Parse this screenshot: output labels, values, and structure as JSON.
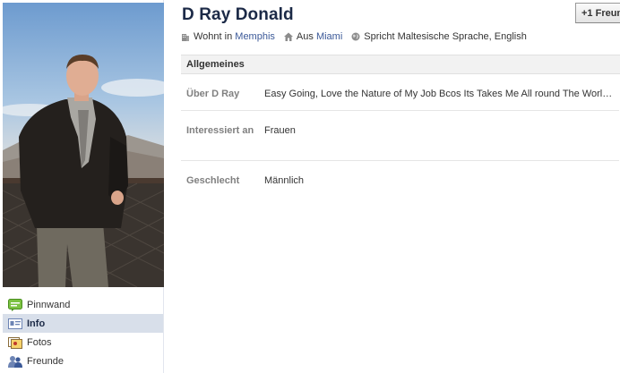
{
  "profile": {
    "name": "D Ray Donald",
    "friend_button_label": "+1 Freun",
    "lives_in_prefix": "Wohnt in",
    "lives_in_city": "Memphis",
    "from_prefix": "Aus",
    "from_city": "Miami",
    "languages": "Spricht Maltesische Sprache, English"
  },
  "nav": {
    "items": [
      {
        "label": "Pinnwand",
        "icon": "wall-icon"
      },
      {
        "label": "Info",
        "icon": "info-icon"
      },
      {
        "label": "Fotos",
        "icon": "photos-icon"
      },
      {
        "label": "Freunde",
        "icon": "friends-icon"
      }
    ],
    "active": "Info"
  },
  "info": {
    "section_title": "Allgemeines",
    "rows": [
      {
        "label": "Über D Ray",
        "value": "Easy Going, Love the Nature of My Job Bcos Its Takes Me All round The World...."
      },
      {
        "label": "Interessiert an",
        "value": "Frauen"
      },
      {
        "label": "Geschlecht",
        "value": "Männlich"
      }
    ]
  },
  "colors": {
    "brand": "#3b5998",
    "name_text": "#1c2a47",
    "active_nav_bg": "#d8dfea",
    "label_gray": "#808080"
  }
}
